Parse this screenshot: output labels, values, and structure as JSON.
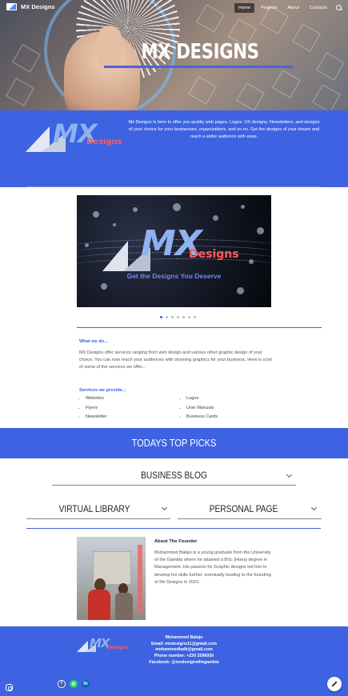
{
  "site": {
    "name": "MX Designs"
  },
  "nav": {
    "items": [
      "Home",
      "Projects",
      "About",
      "Contacts"
    ],
    "active": "Home"
  },
  "hero": {
    "title": "MX DESIGNS"
  },
  "intro": {
    "text": "Mx Designs is here to offer you quality web pages, Logos, UX designs, Newsletters, and designs of your choice for your businesses, organizations, and so on. Get the designs of your dream and reach a wider audience with ease."
  },
  "logo": {
    "mark": "MX",
    "sub": "Designs"
  },
  "slideshow": {
    "tagline": "Get the Designs You Deserve",
    "dot_count": 7,
    "active_dot": 1
  },
  "what_we_do": {
    "heading": "What we do...",
    "text": "MX Designs offer services ranging from web design and various other graphic design of your choice. You can now reach your audiences with stunning graphics for your business. Here is a list of some of the services we offer..."
  },
  "services": {
    "heading": "Services we provide...",
    "left": [
      "Websites",
      "Flyers",
      "Newsletter"
    ],
    "right": [
      "Logos",
      "User Manuals",
      "Business Cards"
    ]
  },
  "top_picks": {
    "title": "TODAYS TOP PICKS"
  },
  "sections": {
    "business_blog": "BUSINESS BLOG",
    "virtual_library": "VIRTUAL LIBRARY",
    "personal_page": "PERSONAL PAGE"
  },
  "founder": {
    "heading": "About The Founder",
    "text": "Muhammed Balajo is a young graduate from the University of the Gambia where he attained a BSc (Hons) degree in Management. His passion for Graphic designs led him to develop his skills further, eventually leading to the founding of Mx Designs in 2022."
  },
  "footer": {
    "lines": [
      "Muhammed Balajo",
      "Email: mxdesigns11@gmail.com",
      "mohammedbalk@gmail.com",
      "Phone number: +220 3596930",
      "Facebook: @mxdesignsthegambia"
    ]
  },
  "colors": {
    "brand_blue": "#3d63e2",
    "accent_red": "#ff5a5a"
  },
  "icons": [
    "search-icon",
    "facebook-icon",
    "whatsapp-icon",
    "linkedin-icon",
    "edit-icon",
    "info-icon"
  ]
}
